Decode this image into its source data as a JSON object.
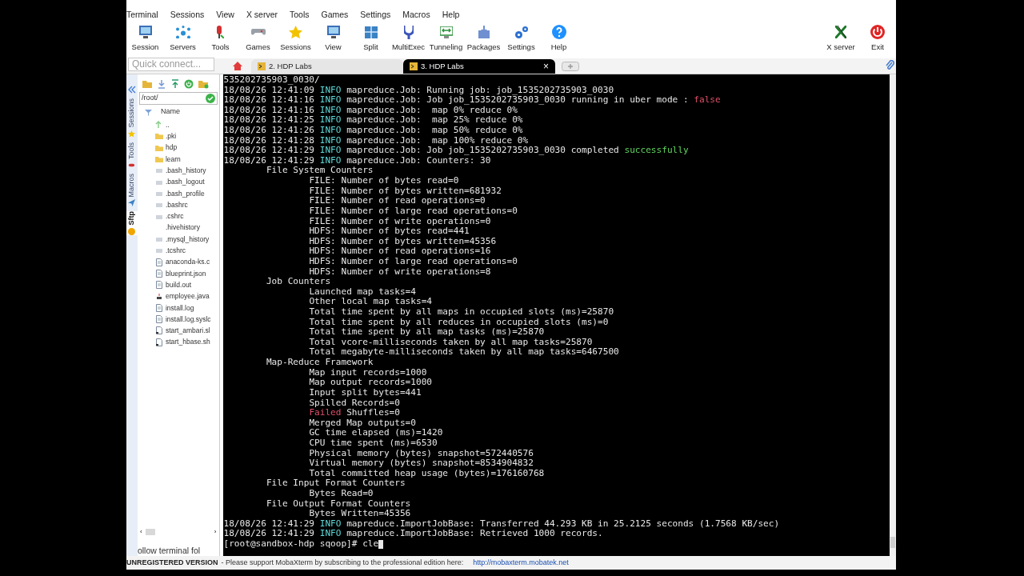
{
  "menu": [
    "Terminal",
    "Sessions",
    "View",
    "X server",
    "Tools",
    "Games",
    "Settings",
    "Macros",
    "Help"
  ],
  "toolbar": [
    {
      "label": "Session",
      "kind": "monitor"
    },
    {
      "label": "Servers",
      "kind": "network"
    },
    {
      "label": "Tools",
      "kind": "tools"
    },
    {
      "label": "Games",
      "kind": "gamepad"
    },
    {
      "label": "Sessions",
      "kind": "star"
    },
    {
      "label": "View",
      "kind": "monitor"
    },
    {
      "label": "Split",
      "kind": "grid"
    },
    {
      "label": "MultiExec",
      "kind": "fork"
    },
    {
      "label": "Tunneling",
      "kind": "tunnel"
    },
    {
      "label": "Packages",
      "kind": "package"
    },
    {
      "label": "Settings",
      "kind": "gears"
    },
    {
      "label": "Help",
      "kind": "help"
    }
  ],
  "toolbar_right": [
    {
      "label": "X server",
      "kind": "x"
    },
    {
      "label": "Exit",
      "kind": "power"
    }
  ],
  "quick_connect": {
    "placeholder": "Quick connect..."
  },
  "tabs": [
    {
      "label": "2. HDP Labs",
      "selected": false
    },
    {
      "label": "3. HDP Labs",
      "selected": true,
      "close": "×"
    }
  ],
  "sidebar": {
    "vertical_tabs": [
      {
        "label": "Sessions",
        "selected": false
      },
      {
        "label": "Tools",
        "selected": false
      },
      {
        "label": "Macros",
        "selected": false
      },
      {
        "label": "Sftp",
        "selected": true
      }
    ],
    "path": "/root/",
    "column": "Name",
    "items": [
      {
        "name": "..",
        "kind": "up"
      },
      {
        "name": ".pki",
        "kind": "folder"
      },
      {
        "name": "hdp",
        "kind": "folder"
      },
      {
        "name": "learn",
        "kind": "folder"
      },
      {
        "name": ".bash_history",
        "kind": "file"
      },
      {
        "name": ".bash_logout",
        "kind": "file"
      },
      {
        "name": ".bash_profile",
        "kind": "file"
      },
      {
        "name": ".bashrc",
        "kind": "file"
      },
      {
        "name": ".cshrc",
        "kind": "file"
      },
      {
        "name": ".hivehistory",
        "kind": "blank"
      },
      {
        "name": ".mysql_history",
        "kind": "file"
      },
      {
        "name": ".tcshrc",
        "kind": "file"
      },
      {
        "name": "anaconda-ks.c",
        "kind": "doc"
      },
      {
        "name": "blueprint.json",
        "kind": "doc"
      },
      {
        "name": "build.out",
        "kind": "doc"
      },
      {
        "name": "employee.java",
        "kind": "java"
      },
      {
        "name": "install.log",
        "kind": "doc"
      },
      {
        "name": "install.log.syslc",
        "kind": "doc"
      },
      {
        "name": "start_ambari.sl",
        "kind": "script"
      },
      {
        "name": "start_hbase.sh",
        "kind": "script"
      }
    ],
    "scroll_left": "‹",
    "scroll_right": "›",
    "follow": "ollow terminal fol"
  },
  "terminal": [
    [
      {
        "text": "535202735903_0030/"
      }
    ],
    [
      {
        "text": "18/08/26 12:41:09 "
      },
      {
        "text": "INFO",
        "color": "#5fd7d7"
      },
      {
        "text": " mapreduce.Job: Running job: job_1535202735903_0030"
      }
    ],
    [
      {
        "text": "18/08/26 12:41:16 "
      },
      {
        "text": "INFO",
        "color": "#5fd7d7"
      },
      {
        "text": " mapreduce.Job: Job job_1535202735903_0030 running in uber mode : "
      },
      {
        "text": "false",
        "color": "#e0506a"
      }
    ],
    [
      {
        "text": "18/08/26 12:41:16 "
      },
      {
        "text": "INFO",
        "color": "#5fd7d7"
      },
      {
        "text": " mapreduce.Job:  map 0% reduce 0%"
      }
    ],
    [
      {
        "text": "18/08/26 12:41:25 "
      },
      {
        "text": "INFO",
        "color": "#5fd7d7"
      },
      {
        "text": " mapreduce.Job:  map 25% reduce 0%"
      }
    ],
    [
      {
        "text": "18/08/26 12:41:26 "
      },
      {
        "text": "INFO",
        "color": "#5fd7d7"
      },
      {
        "text": " mapreduce.Job:  map 50% reduce 0%"
      }
    ],
    [
      {
        "text": "18/08/26 12:41:28 "
      },
      {
        "text": "INFO",
        "color": "#5fd7d7"
      },
      {
        "text": " mapreduce.Job:  map 100% reduce 0%"
      }
    ],
    [
      {
        "text": "18/08/26 12:41:29 "
      },
      {
        "text": "INFO",
        "color": "#5fd7d7"
      },
      {
        "text": " mapreduce.Job: Job job_1535202735903_0030 completed "
      },
      {
        "text": "successfully",
        "color": "#5fd75f"
      }
    ],
    [
      {
        "text": "18/08/26 12:41:29 "
      },
      {
        "text": "INFO",
        "color": "#5fd7d7"
      },
      {
        "text": " mapreduce.Job: Counters: 30"
      }
    ],
    [
      {
        "text": "        File System Counters"
      }
    ],
    [
      {
        "text": "                FILE: Number of bytes read=0"
      }
    ],
    [
      {
        "text": "                FILE: Number of bytes written=681932"
      }
    ],
    [
      {
        "text": "                FILE: Number of read operations=0"
      }
    ],
    [
      {
        "text": "                FILE: Number of large read operations=0"
      }
    ],
    [
      {
        "text": "                FILE: Number of write operations=0"
      }
    ],
    [
      {
        "text": "                HDFS: Number of bytes read=441"
      }
    ],
    [
      {
        "text": "                HDFS: Number of bytes written=45356"
      }
    ],
    [
      {
        "text": "                HDFS: Number of read operations=16"
      }
    ],
    [
      {
        "text": "                HDFS: Number of large read operations=0"
      }
    ],
    [
      {
        "text": "                HDFS: Number of write operations=8"
      }
    ],
    [
      {
        "text": "        Job Counters "
      }
    ],
    [
      {
        "text": "                Launched map tasks=4"
      }
    ],
    [
      {
        "text": "                Other local map tasks=4"
      }
    ],
    [
      {
        "text": "                Total time spent by all maps in occupied slots (ms)=25870"
      }
    ],
    [
      {
        "text": "                Total time spent by all reduces in occupied slots (ms)=0"
      }
    ],
    [
      {
        "text": "                Total time spent by all map tasks (ms)=25870"
      }
    ],
    [
      {
        "text": "                Total vcore-milliseconds taken by all map tasks=25870"
      }
    ],
    [
      {
        "text": "                Total megabyte-milliseconds taken by all map tasks=6467500"
      }
    ],
    [
      {
        "text": "        Map-Reduce Framework"
      }
    ],
    [
      {
        "text": "                Map input records=1000"
      }
    ],
    [
      {
        "text": "                Map output records=1000"
      }
    ],
    [
      {
        "text": "                Input split bytes=441"
      }
    ],
    [
      {
        "text": "                Spilled Records=0"
      }
    ],
    [
      {
        "text": "                Failed",
        "color": "#e0506a"
      },
      {
        "text": " Shuffles=0"
      }
    ],
    [
      {
        "text": "                Merged Map outputs=0"
      }
    ],
    [
      {
        "text": "                GC time elapsed (ms)=1420"
      }
    ],
    [
      {
        "text": "                CPU time spent (ms)=6530"
      }
    ],
    [
      {
        "text": "                Physical memory (bytes) snapshot=572440576"
      }
    ],
    [
      {
        "text": "                Virtual memory (bytes) snapshot=8534904832"
      }
    ],
    [
      {
        "text": "                Total committed heap usage (bytes)=176160768"
      }
    ],
    [
      {
        "text": "        File Input Format Counters "
      }
    ],
    [
      {
        "text": "                Bytes Read=0"
      }
    ],
    [
      {
        "text": "        File Output Format Counters "
      }
    ],
    [
      {
        "text": "                Bytes Written=45356"
      }
    ],
    [
      {
        "text": "18/08/26 12:41:29 "
      },
      {
        "text": "INFO",
        "color": "#5fd7d7"
      },
      {
        "text": " mapreduce.ImportJobBase: Transferred 44.293 KB in 25.2125 seconds (1.7568 KB/sec)"
      }
    ],
    [
      {
        "text": "18/08/26 12:41:29 "
      },
      {
        "text": "INFO",
        "color": "#5fd7d7"
      },
      {
        "text": " mapreduce.ImportJobBase: Retrieved 1000 records."
      }
    ],
    [
      {
        "text": "[root@sandbox-hdp sqoop]# cle"
      }
    ]
  ],
  "status": {
    "label": "UNREGISTERED VERSION",
    "message": "-  Please support MobaXterm by subscribing to the professional edition here:",
    "link": "http://mobaxterm.mobatek.net"
  }
}
